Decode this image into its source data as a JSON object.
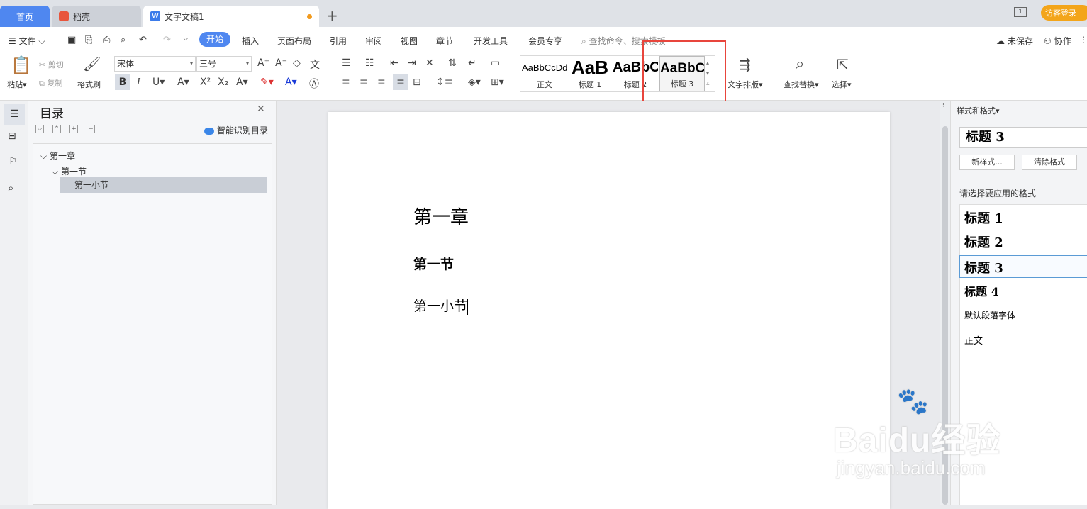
{
  "tabs": {
    "home": "首页",
    "daoke": "稻壳",
    "doc": "文字文稿1",
    "visit": "访客登录"
  },
  "menu": {
    "file": "文件",
    "start": "开始",
    "insert": "插入",
    "layout": "页面布局",
    "reference": "引用",
    "review": "审阅",
    "view": "视图",
    "chapter": "章节",
    "devtools": "开发工具",
    "vip": "会员专享",
    "search_placeholder": "查找命令、搜索模板",
    "unsaved": "未保存",
    "collab": "协作"
  },
  "ribbon": {
    "paste": "粘贴",
    "cut": "剪切",
    "copy": "复制",
    "format_painter": "格式刷",
    "font_name": "宋体",
    "font_size": "三号",
    "text_layout": "文字排版",
    "find_replace": "查找替换",
    "select": "选择",
    "styles": [
      {
        "preview": "AaBbCcDd",
        "label": "正文"
      },
      {
        "preview": "AaB",
        "label": "标题 1"
      },
      {
        "preview": "AaBbC",
        "label": "标题 2"
      },
      {
        "preview": "AaBbC",
        "label": "标题 3"
      }
    ]
  },
  "nav": {
    "title": "目录",
    "smart_toc": "智能识别目录",
    "items": [
      {
        "label": "第一章"
      },
      {
        "label": "第一节"
      },
      {
        "label": "第一小节"
      }
    ]
  },
  "doc": {
    "h1": "第一章",
    "h2": "第一节",
    "h3": "第一小节"
  },
  "stylepane": {
    "title": "样式和格式",
    "current": "标题 3",
    "new_style": "新样式...",
    "clear_format": "清除格式",
    "prompt": "请选择要应用的格式",
    "items": [
      {
        "label": "标题 1"
      },
      {
        "label": "标题 2"
      },
      {
        "label": "标题 3"
      },
      {
        "label": "标题 4"
      },
      {
        "label": "默认段落字体"
      },
      {
        "label": "正文"
      }
    ]
  },
  "watermark": {
    "brand": "Baidu经验",
    "url": "jingyan.baidu.com"
  }
}
